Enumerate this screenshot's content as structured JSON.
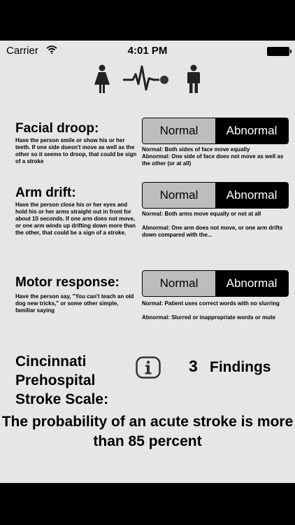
{
  "status_bar": {
    "carrier": "Carrier",
    "time": "4:01 PM"
  },
  "header_icons": [
    "female-person-icon",
    "heartbeat-ekg-icon",
    "male-person-icon"
  ],
  "sections": [
    {
      "title": "Facial droop:",
      "description": "Have the person smile or show his or her teeth. If one side doesn't move as well as the other so it seems to droop, that could be sign of a stroke",
      "options": [
        "Normal",
        "Abnormal"
      ],
      "selected": "Abnormal",
      "note_normal": "Normal: Both sides of face move equally",
      "note_abnormal": "Abnormal: One side of face does not move as well as the other (or at all)"
    },
    {
      "title": "Arm drift:",
      "description": "Have the person close his or her eyes and hold his or her arms straight out in front for about 10 seconds. If one arm does not move, or one arm winds up drifting down more than the other, that could be a sign of a stroke.",
      "options": [
        "Normal",
        "Abnormal"
      ],
      "selected": "Abnormal",
      "note_normal": "Normal: Both arms move equally or not at all",
      "note_abnormal": "Abnormal: One arm does not move, or one arm drifts down compared with the..."
    },
    {
      "title": "Motor response:",
      "description": "Have the person say, \"You can't teach an old dog new tricks,\" or some other simple, familiar saying",
      "options": [
        "Normal",
        "Abnormal"
      ],
      "selected": "Abnormal",
      "note_normal": "Normal: Patient uses correct words with no slurring",
      "note_abnormal": "Abnormal: Slurred or inappropriate words or mute"
    }
  ],
  "summary": {
    "scale_name": "Cincinnati Prehospital Stroke Scale:",
    "findings_count": "3",
    "findings_label": "Findings",
    "probability_text": "The probability of an acute stroke is more than 85 percent"
  }
}
